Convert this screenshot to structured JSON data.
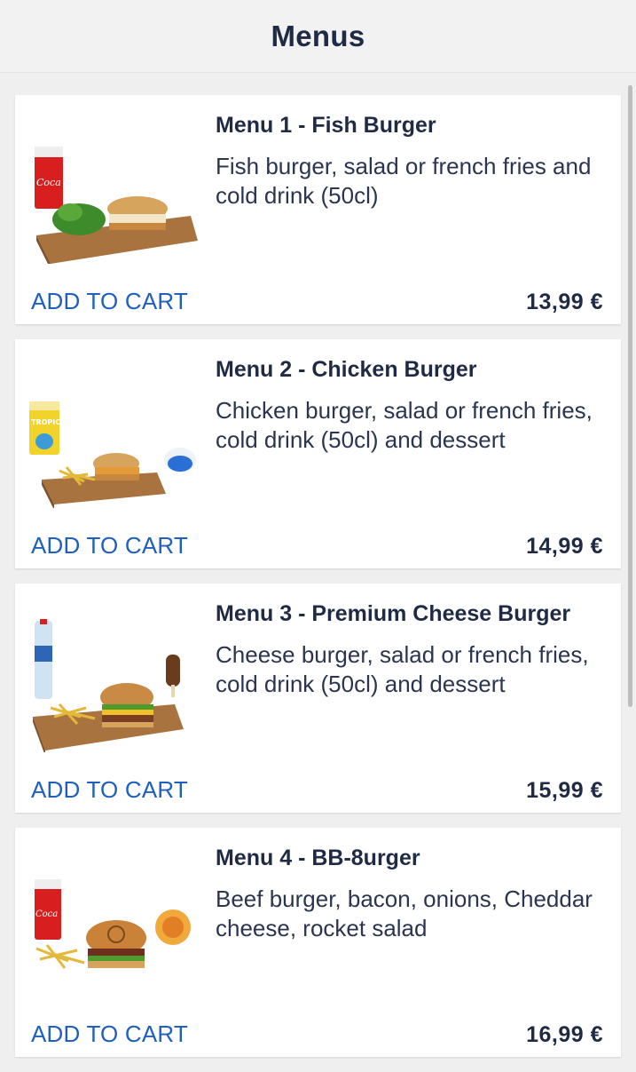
{
  "header": {
    "title": "Menus"
  },
  "menus": [
    {
      "title": "Menu 1 - Fish Burger",
      "description": "Fish burger, salad or french fries and cold drink (50cl)",
      "add_label": "ADD TO CART",
      "price": "13,99 €",
      "image": "fish-burger-meal-icon"
    },
    {
      "title": "Menu 2 - Chicken Burger",
      "description": "Chicken burger, salad or french fries, cold drink (50cl) and dessert",
      "add_label": "ADD TO CART",
      "price": "14,99 €",
      "image": "chicken-burger-meal-icon"
    },
    {
      "title": "Menu 3 - Premium Cheese Burger",
      "description": "Cheese burger, salad or french fries, cold drink (50cl) and dessert",
      "add_label": "ADD TO CART",
      "price": "15,99 €",
      "image": "cheese-burger-meal-icon"
    },
    {
      "title": "Menu 4 - BB-8urger",
      "description": "Beef burger, bacon, onions, Cheddar cheese, rocket salad",
      "add_label": "ADD TO CART",
      "price": "16,99 €",
      "image": "bb8-burger-meal-icon"
    }
  ],
  "colors": {
    "accent": "#1f5fbf",
    "text": "#1f2a44",
    "background": "#efefef"
  }
}
